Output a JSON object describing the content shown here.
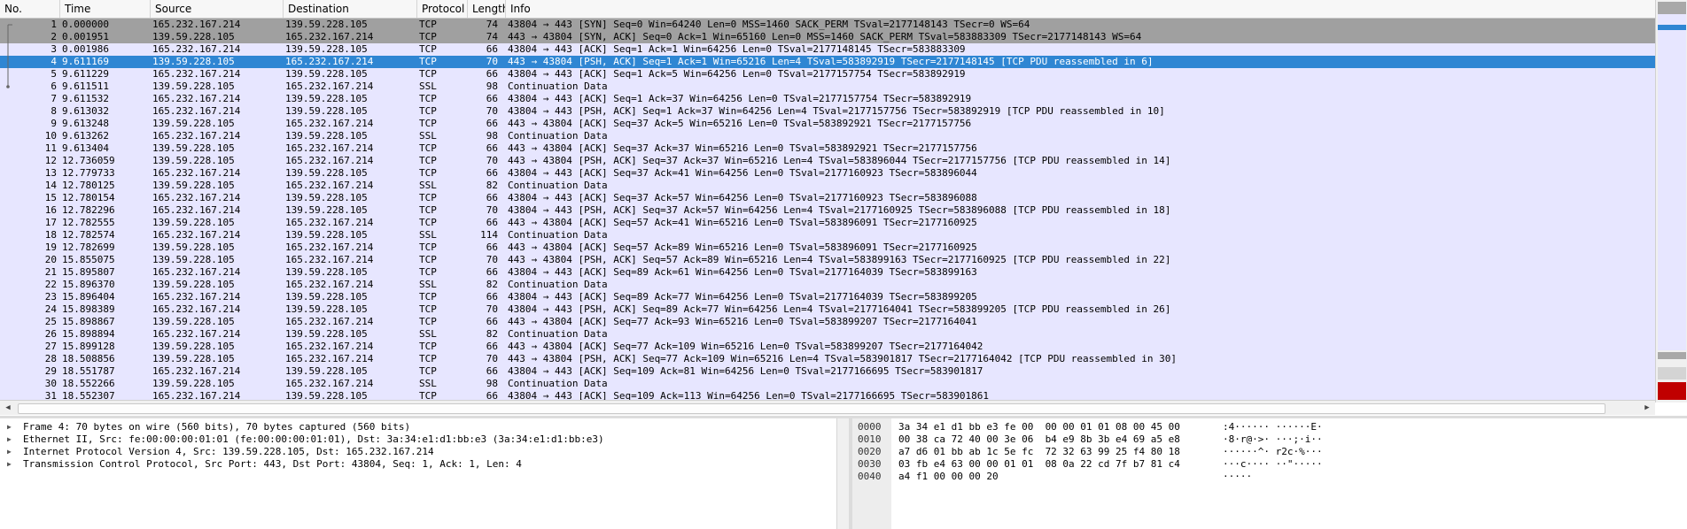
{
  "columns": [
    "No.",
    "Time",
    "Source",
    "Destination",
    "Protocol",
    "Length",
    "Info"
  ],
  "packets": [
    {
      "no": "1",
      "time": "0.000000",
      "src": "165.232.167.214",
      "dst": "139.59.228.105",
      "proto": "TCP",
      "len": "74",
      "info": "43804 → 443 [SYN] Seq=0 Win=64240 Len=0 MSS=1460 SACK_PERM TSval=2177148143 TSecr=0 WS=64",
      "style": "syn"
    },
    {
      "no": "2",
      "time": "0.001951",
      "src": "139.59.228.105",
      "dst": "165.232.167.214",
      "proto": "TCP",
      "len": "74",
      "info": "443 → 43804 [SYN, ACK] Seq=0 Ack=1 Win=65160 Len=0 MSS=1460 SACK_PERM TSval=583883309 TSecr=2177148143 WS=64",
      "style": "syn"
    },
    {
      "no": "3",
      "time": "0.001986",
      "src": "165.232.167.214",
      "dst": "139.59.228.105",
      "proto": "TCP",
      "len": "66",
      "info": "43804 → 443 [ACK] Seq=1 Ack=1 Win=64256 Len=0 TSval=2177148145 TSecr=583883309",
      "style": "norm"
    },
    {
      "no": "4",
      "time": "9.611169",
      "src": "139.59.228.105",
      "dst": "165.232.167.214",
      "proto": "TCP",
      "len": "70",
      "info": "443 → 43804 [PSH, ACK] Seq=1 Ack=1 Win=65216 Len=4 TSval=583892919 TSecr=2177148145 [TCP PDU reassembled in 6]",
      "style": "sel"
    },
    {
      "no": "5",
      "time": "9.611229",
      "src": "165.232.167.214",
      "dst": "139.59.228.105",
      "proto": "TCP",
      "len": "66",
      "info": "43804 → 443 [ACK] Seq=1 Ack=5 Win=64256 Len=0 TSval=2177157754 TSecr=583892919",
      "style": "norm"
    },
    {
      "no": "6",
      "time": "9.611511",
      "src": "139.59.228.105",
      "dst": "165.232.167.214",
      "proto": "SSL",
      "len": "98",
      "info": "Continuation Data",
      "style": "norm"
    },
    {
      "no": "7",
      "time": "9.611532",
      "src": "165.232.167.214",
      "dst": "139.59.228.105",
      "proto": "TCP",
      "len": "66",
      "info": "43804 → 443 [ACK] Seq=1 Ack=37 Win=64256 Len=0 TSval=2177157754 TSecr=583892919",
      "style": "norm"
    },
    {
      "no": "8",
      "time": "9.613032",
      "src": "165.232.167.214",
      "dst": "139.59.228.105",
      "proto": "TCP",
      "len": "70",
      "info": "43804 → 443 [PSH, ACK] Seq=1 Ack=37 Win=64256 Len=4 TSval=2177157756 TSecr=583892919 [TCP PDU reassembled in 10]",
      "style": "norm"
    },
    {
      "no": "9",
      "time": "9.613248",
      "src": "139.59.228.105",
      "dst": "165.232.167.214",
      "proto": "TCP",
      "len": "66",
      "info": "443 → 43804 [ACK] Seq=37 Ack=5 Win=65216 Len=0 TSval=583892921 TSecr=2177157756",
      "style": "norm"
    },
    {
      "no": "10",
      "time": "9.613262",
      "src": "165.232.167.214",
      "dst": "139.59.228.105",
      "proto": "SSL",
      "len": "98",
      "info": "Continuation Data",
      "style": "norm"
    },
    {
      "no": "11",
      "time": "9.613404",
      "src": "139.59.228.105",
      "dst": "165.232.167.214",
      "proto": "TCP",
      "len": "66",
      "info": "443 → 43804 [ACK] Seq=37 Ack=37 Win=65216 Len=0 TSval=583892921 TSecr=2177157756",
      "style": "norm"
    },
    {
      "no": "12",
      "time": "12.736059",
      "src": "139.59.228.105",
      "dst": "165.232.167.214",
      "proto": "TCP",
      "len": "70",
      "info": "443 → 43804 [PSH, ACK] Seq=37 Ack=37 Win=65216 Len=4 TSval=583896044 TSecr=2177157756 [TCP PDU reassembled in 14]",
      "style": "norm"
    },
    {
      "no": "13",
      "time": "12.779733",
      "src": "165.232.167.214",
      "dst": "139.59.228.105",
      "proto": "TCP",
      "len": "66",
      "info": "43804 → 443 [ACK] Seq=37 Ack=41 Win=64256 Len=0 TSval=2177160923 TSecr=583896044",
      "style": "norm"
    },
    {
      "no": "14",
      "time": "12.780125",
      "src": "139.59.228.105",
      "dst": "165.232.167.214",
      "proto": "SSL",
      "len": "82",
      "info": "Continuation Data",
      "style": "norm"
    },
    {
      "no": "15",
      "time": "12.780154",
      "src": "165.232.167.214",
      "dst": "139.59.228.105",
      "proto": "TCP",
      "len": "66",
      "info": "43804 → 443 [ACK] Seq=37 Ack=57 Win=64256 Len=0 TSval=2177160923 TSecr=583896088",
      "style": "norm"
    },
    {
      "no": "16",
      "time": "12.782296",
      "src": "165.232.167.214",
      "dst": "139.59.228.105",
      "proto": "TCP",
      "len": "70",
      "info": "43804 → 443 [PSH, ACK] Seq=37 Ack=57 Win=64256 Len=4 TSval=2177160925 TSecr=583896088 [TCP PDU reassembled in 18]",
      "style": "norm"
    },
    {
      "no": "17",
      "time": "12.782555",
      "src": "139.59.228.105",
      "dst": "165.232.167.214",
      "proto": "TCP",
      "len": "66",
      "info": "443 → 43804 [ACK] Seq=57 Ack=41 Win=65216 Len=0 TSval=583896091 TSecr=2177160925",
      "style": "norm"
    },
    {
      "no": "18",
      "time": "12.782574",
      "src": "165.232.167.214",
      "dst": "139.59.228.105",
      "proto": "SSL",
      "len": "114",
      "info": "Continuation Data",
      "style": "norm"
    },
    {
      "no": "19",
      "time": "12.782699",
      "src": "139.59.228.105",
      "dst": "165.232.167.214",
      "proto": "TCP",
      "len": "66",
      "info": "443 → 43804 [ACK] Seq=57 Ack=89 Win=65216 Len=0 TSval=583896091 TSecr=2177160925",
      "style": "norm"
    },
    {
      "no": "20",
      "time": "15.855075",
      "src": "139.59.228.105",
      "dst": "165.232.167.214",
      "proto": "TCP",
      "len": "70",
      "info": "443 → 43804 [PSH, ACK] Seq=57 Ack=89 Win=65216 Len=4 TSval=583899163 TSecr=2177160925 [TCP PDU reassembled in 22]",
      "style": "norm"
    },
    {
      "no": "21",
      "time": "15.895807",
      "src": "165.232.167.214",
      "dst": "139.59.228.105",
      "proto": "TCP",
      "len": "66",
      "info": "43804 → 443 [ACK] Seq=89 Ack=61 Win=64256 Len=0 TSval=2177164039 TSecr=583899163",
      "style": "norm"
    },
    {
      "no": "22",
      "time": "15.896370",
      "src": "139.59.228.105",
      "dst": "165.232.167.214",
      "proto": "SSL",
      "len": "82",
      "info": "Continuation Data",
      "style": "norm"
    },
    {
      "no": "23",
      "time": "15.896404",
      "src": "165.232.167.214",
      "dst": "139.59.228.105",
      "proto": "TCP",
      "len": "66",
      "info": "43804 → 443 [ACK] Seq=89 Ack=77 Win=64256 Len=0 TSval=2177164039 TSecr=583899205",
      "style": "norm"
    },
    {
      "no": "24",
      "time": "15.898389",
      "src": "165.232.167.214",
      "dst": "139.59.228.105",
      "proto": "TCP",
      "len": "70",
      "info": "43804 → 443 [PSH, ACK] Seq=89 Ack=77 Win=64256 Len=4 TSval=2177164041 TSecr=583899205 [TCP PDU reassembled in 26]",
      "style": "norm"
    },
    {
      "no": "25",
      "time": "15.898867",
      "src": "139.59.228.105",
      "dst": "165.232.167.214",
      "proto": "TCP",
      "len": "66",
      "info": "443 → 43804 [ACK] Seq=77 Ack=93 Win=65216 Len=0 TSval=583899207 TSecr=2177164041",
      "style": "norm"
    },
    {
      "no": "26",
      "time": "15.898894",
      "src": "165.232.167.214",
      "dst": "139.59.228.105",
      "proto": "SSL",
      "len": "82",
      "info": "Continuation Data",
      "style": "norm"
    },
    {
      "no": "27",
      "time": "15.899128",
      "src": "139.59.228.105",
      "dst": "165.232.167.214",
      "proto": "TCP",
      "len": "66",
      "info": "443 → 43804 [ACK] Seq=77 Ack=109 Win=65216 Len=0 TSval=583899207 TSecr=2177164042",
      "style": "norm"
    },
    {
      "no": "28",
      "time": "18.508856",
      "src": "139.59.228.105",
      "dst": "165.232.167.214",
      "proto": "TCP",
      "len": "70",
      "info": "443 → 43804 [PSH, ACK] Seq=77 Ack=109 Win=65216 Len=4 TSval=583901817 TSecr=2177164042 [TCP PDU reassembled in 30]",
      "style": "norm"
    },
    {
      "no": "29",
      "time": "18.551787",
      "src": "165.232.167.214",
      "dst": "139.59.228.105",
      "proto": "TCP",
      "len": "66",
      "info": "43804 → 443 [ACK] Seq=109 Ack=81 Win=64256 Len=0 TSval=2177166695 TSecr=583901817",
      "style": "norm"
    },
    {
      "no": "30",
      "time": "18.552266",
      "src": "139.59.228.105",
      "dst": "165.232.167.214",
      "proto": "SSL",
      "len": "98",
      "info": "Continuation Data",
      "style": "norm"
    },
    {
      "no": "31",
      "time": "18.552307",
      "src": "165.232.167.214",
      "dst": "139.59.228.105",
      "proto": "TCP",
      "len": "66",
      "info": "43804 → 443 [ACK] Seq=109 Ack=113 Win=64256 Len=0 TSval=2177166695 TSecr=583901861",
      "style": "norm"
    }
  ],
  "details": [
    "Frame 4: 70 bytes on wire (560 bits), 70 bytes captured (560 bits)",
    "Ethernet II, Src: fe:00:00:00:01:01 (fe:00:00:00:01:01), Dst: 3a:34:e1:d1:bb:e3 (3a:34:e1:d1:bb:e3)",
    "Internet Protocol Version 4, Src: 139.59.228.105, Dst: 165.232.167.214",
    "Transmission Control Protocol, Src Port: 443, Dst Port: 43804, Seq: 1, Ack: 1, Len: 4"
  ],
  "bytes": [
    {
      "off": "0000",
      "hex": "3a 34 e1 d1 bb e3 fe 00  00 00 01 01 08 00 45 00",
      "ascii": ":4······ ······E·"
    },
    {
      "off": "0010",
      "hex": "00 38 ca 72 40 00 3e 06  b4 e9 8b 3b e4 69 a5 e8",
      "ascii": "·8·r@·>· ···;·i··"
    },
    {
      "off": "0020",
      "hex": "a7 d6 01 bb ab 1c 5e fc  72 32 63 99 25 f4 80 18",
      "ascii": "······^· r2c·%···"
    },
    {
      "off": "0030",
      "hex": "03 fb e4 63 00 00 01 01  08 0a 22 cd 7f b7 81 c4",
      "ascii": "···c···· ··\"·····"
    },
    {
      "off": "0040",
      "hex": "a4 f1 00 00 00 20",
      "ascii": "·····"
    }
  ],
  "colors": {
    "selected": "#2f86d3",
    "syn": "#a0a0a0",
    "normal": "#e7e6ff",
    "minimap_alert": "#c00000"
  }
}
